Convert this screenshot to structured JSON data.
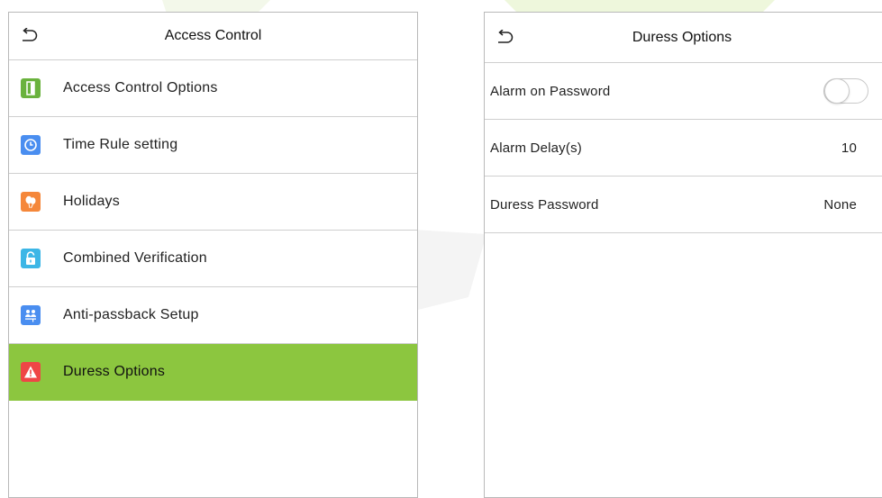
{
  "colors": {
    "active_bg": "#8cc63f",
    "border": "#cfcfcf",
    "icon_green": "#6ab23d",
    "icon_blue": "#4a8ef0",
    "icon_orange": "#f5873a",
    "icon_cyan": "#3cb6e6",
    "icon_red": "#ef4646"
  },
  "left_panel": {
    "title": "Access Control",
    "back_icon": "back-arrow-icon",
    "items": [
      {
        "label": "Access Control Options",
        "icon": "door-icon",
        "color": "#6ab23d"
      },
      {
        "label": "Time Rule setting",
        "icon": "clock-icon",
        "color": "#4a8ef0"
      },
      {
        "label": "Holidays",
        "icon": "balloons-icon",
        "color": "#f5873a"
      },
      {
        "label": "Combined Verification",
        "icon": "lock-icon",
        "color": "#3cb6e6"
      },
      {
        "label": "Anti-passback Setup",
        "icon": "users-icon",
        "color": "#4a8ef0"
      },
      {
        "label": "Duress Options",
        "icon": "warning-icon",
        "color": "#ef4646",
        "active": true
      }
    ]
  },
  "right_panel": {
    "title": "Duress Options",
    "back_icon": "back-arrow-icon",
    "rows": [
      {
        "label": "Alarm on Password",
        "control": "toggle",
        "value": "off"
      },
      {
        "label": "Alarm Delay(s)",
        "value": "10"
      },
      {
        "label": "Duress Password",
        "value": "None"
      }
    ]
  }
}
